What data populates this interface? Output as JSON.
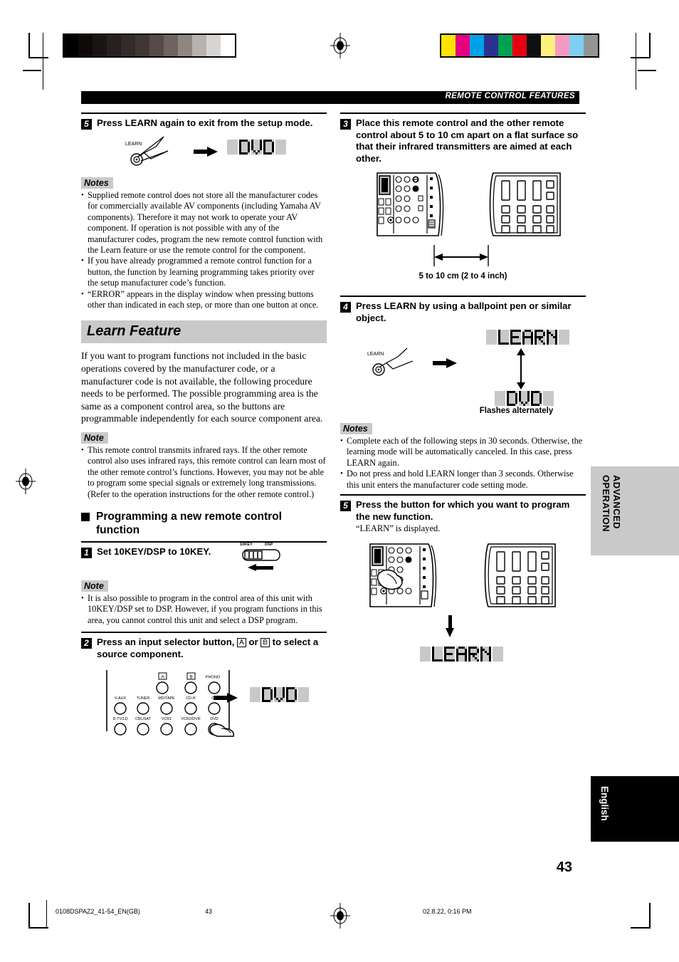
{
  "header": {
    "chapter": "REMOTE CONTROL FEATURES"
  },
  "left_column": {
    "step5_prev": {
      "number": "5",
      "text": "Press LEARN again to exit from the setup mode.",
      "button_label": "LEARN",
      "display_text": "DVD"
    },
    "notes_label": "Notes",
    "notes": [
      "Supplied remote control does not store all the manufacturer codes for commercially available AV components (including Yamaha AV components). Therefore it may not work to operate your AV component. If operation is not possible with any of the manufacturer codes, program the new remote control function with the Learn feature or use the remote control for the component.",
      "If you have already programmed a remote control function for a button, the function by learning programming takes priority over the setup manufacturer code’s function.",
      "“ERROR” appears in the display window when pressing buttons other than indicated in each step, or more than one button at once."
    ],
    "section_title": "Learn Feature",
    "section_body": "If you want to program functions not included in the basic operations covered by the manufacturer code, or a manufacturer code is not available, the following procedure needs to be performed. The possible programming area is the same as a component control area, so the buttons are programmable independently for each source component area.",
    "note_label": "Note",
    "section_note": "This remote control transmits infrared rays. If the other remote control also uses infrared rays, this remote control can learn most of the other remote control’s functions. However, you may not be able to program some special signals or extremely long transmissions. (Refer to the operation instructions for the other remote control.)",
    "subsection_title": "Programming a new remote control function",
    "step1": {
      "number": "1",
      "text": "Set 10KEY/DSP to 10KEY.",
      "switch_label_left": "10KEY",
      "switch_label_right": "DSP"
    },
    "note1_label": "Note",
    "note1": "It is also possible to program in the control area of this unit with 10KEY/DSP set to DSP. However, if you program functions in this area, you cannot control this unit and select a DSP program.",
    "step2": {
      "number": "2",
      "text_part1": "Press an input selector button,",
      "key_a": "A",
      "text_or": "or",
      "key_b": "B",
      "text_part2": "to select a source component.",
      "display_text": "DVD",
      "selector_labels_row1": [
        "A",
        "B",
        "PHONO"
      ],
      "selector_labels_row2": [
        "V-AUX",
        "TUNER",
        "MD/TAPE",
        "CD-R",
        "CD"
      ],
      "selector_labels_row3": [
        "D-TV/LD",
        "CBL/SAT",
        "VCR1",
        "VCR2/DVR",
        "DVD"
      ]
    }
  },
  "right_column": {
    "step3": {
      "number": "3",
      "text": "Place this remote control and the other remote control about 5 to 10 cm apart on a flat surface so that their infrared transmitters are aimed at each other.",
      "dimension_caption": "5 to 10 cm (2 to 4 inch)"
    },
    "step4": {
      "number": "4",
      "text": "Press LEARN by using a ballpoint pen or similar object.",
      "button_label": "LEARN",
      "display_top": "LEARN",
      "display_bottom": "DVD",
      "flash_caption": "Flashes alternately"
    },
    "notes_label": "Notes",
    "notes": [
      "Complete each of the following steps in 30 seconds. Otherwise, the learning mode will be automatically canceled. In this case, press LEARN again.",
      "Do not press and hold LEARN longer than 3 seconds. Otherwise this unit enters the manufacturer code setting mode."
    ],
    "step5": {
      "number": "5",
      "text": "Press the button for which you want to program the new function.",
      "subtext": "“LEARN” is displayed.",
      "display_text": "LEARN"
    }
  },
  "side_tabs": {
    "advanced": "ADVANCED\nOPERATION",
    "language": "English"
  },
  "page_number": "43",
  "footer": {
    "file": "0108DSPAZ2_41-54_EN(GB)",
    "page": "43",
    "timestamp": "02.8.22, 0:16 PM"
  },
  "calibration": {
    "grey_steps": [
      "#000000",
      "#0d0a09",
      "#1a1513",
      "#262020",
      "#332b29",
      "#403634",
      "#554a47",
      "#6e635f",
      "#8f8682",
      "#b8b2ae",
      "#d8d4d1",
      "#ffffff"
    ],
    "colors": [
      "#ffe400",
      "#e5007f",
      "#00a0e9",
      "#2b3190",
      "#00a051",
      "#e60012",
      "#0f0f0f",
      "#fdf07c",
      "#f49ac1",
      "#7ecef4",
      "#949494"
    ]
  }
}
